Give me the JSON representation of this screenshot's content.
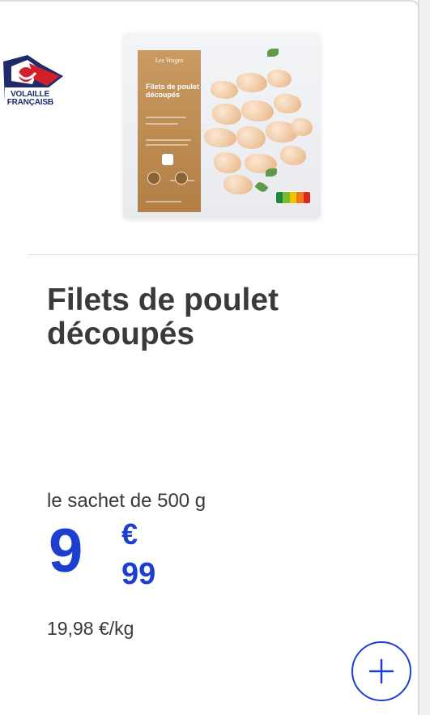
{
  "logo": {
    "label_line1": "VOLAILLE",
    "label_line2": "FRANÇAISE",
    "icon": "volaille-francaise-logo-icon"
  },
  "product_image": {
    "bag_brand": "Les Vosges",
    "bag_title": "Filets de poulet découpés",
    "icon": "product-bag-image"
  },
  "product": {
    "name_line1": "Filets de poulet",
    "name_line2": "découpés",
    "pack": "le sachet de 500 g",
    "price_integer": "9",
    "price_currency": "€",
    "price_decimal": "99",
    "unit_price": "19,98 €/kg"
  },
  "actions": {
    "add_icon": "plus-icon"
  },
  "colors": {
    "price": "#1c3fd0",
    "text": "#3a3a3a",
    "accent": "#1c3fd0"
  }
}
